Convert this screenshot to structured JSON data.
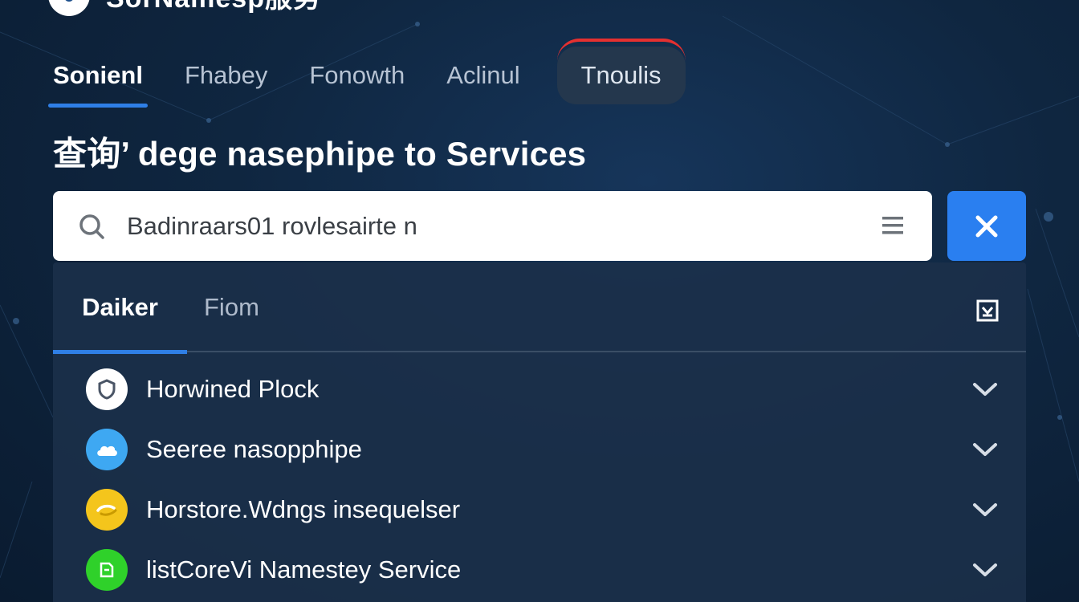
{
  "header": {
    "title": "SorNamesp服务"
  },
  "tabs": [
    {
      "label": "Sonienl",
      "state": "active"
    },
    {
      "label": "Fhabey",
      "state": "normal"
    },
    {
      "label": "Fonowth",
      "state": "normal"
    },
    {
      "label": "Aclinul",
      "state": "normal"
    },
    {
      "label": "Tnoulis",
      "state": "highlight"
    }
  ],
  "heading": "查询’ dege nasephipe to Services",
  "search": {
    "value": "Badinraars01 rovlesairte n",
    "placeholder": ""
  },
  "panel": {
    "tabs": [
      {
        "label": "Daiker",
        "state": "active"
      },
      {
        "label": "Fiom",
        "state": "inactive"
      }
    ],
    "items": [
      {
        "label": "Horwined Plock",
        "icon": "shield-icon",
        "icon_color": "#ffffff"
      },
      {
        "label": "Seeree nasopphipe",
        "icon": "cloud-icon",
        "icon_color": "#3ea8f2"
      },
      {
        "label": "Horstore.Wdngs insequelser",
        "icon": "link-icon",
        "icon_color": "#f4c51c"
      },
      {
        "label": "listCoreVi Namestey Service",
        "icon": "box-icon",
        "icon_color": "#2fd12a"
      }
    ]
  },
  "colors": {
    "accent": "#2f7fe6",
    "close_button": "#2a7ff0",
    "highlight_border": "#e53030"
  }
}
